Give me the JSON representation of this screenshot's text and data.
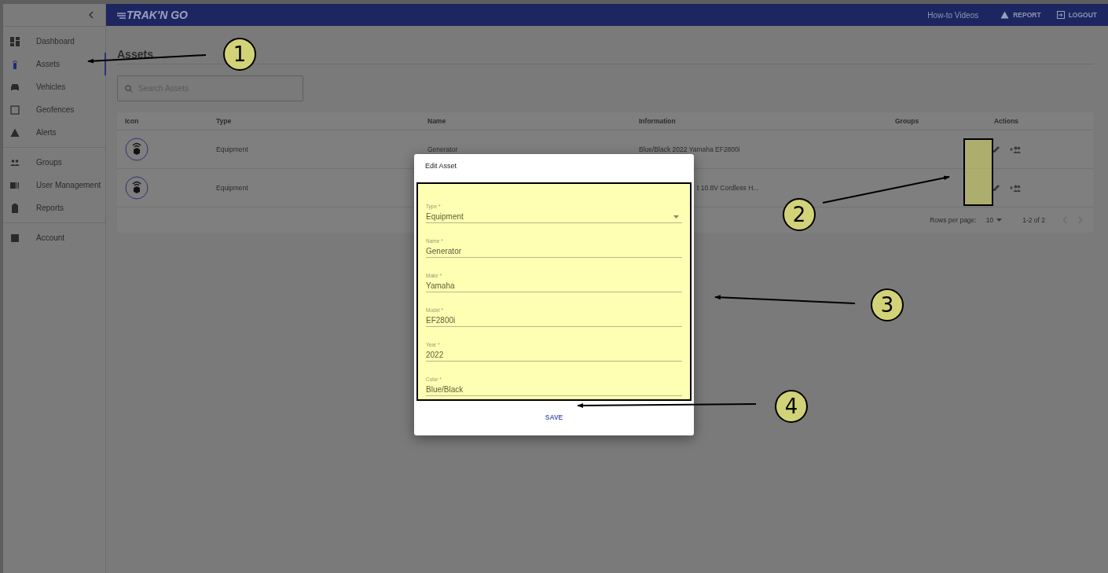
{
  "top_bar": {
    "logo": "TRAK'N GO",
    "links": [
      {
        "label": "How-to Videos",
        "kind": "text"
      },
      {
        "label": "REPORT",
        "kind": "report"
      },
      {
        "label": "LOGOUT",
        "kind": "logout"
      }
    ]
  },
  "sidebar": {
    "sections": [
      {
        "items": [
          {
            "label": "Dashboard",
            "selected": false
          },
          {
            "label": "Assets",
            "selected": true
          },
          {
            "label": "Vehicles",
            "selected": false
          },
          {
            "label": "Geofences",
            "selected": false
          },
          {
            "label": "Alerts",
            "selected": false
          }
        ]
      },
      {
        "items": [
          {
            "label": "Groups",
            "selected": false
          },
          {
            "label": "User Management",
            "selected": false
          },
          {
            "label": "Reports",
            "selected": false
          }
        ]
      },
      {
        "items": [
          {
            "label": "Account",
            "selected": false
          }
        ]
      }
    ]
  },
  "page": {
    "title": "Assets",
    "search": {
      "placeholder": "Search Assets"
    }
  },
  "table": {
    "columns": [
      "Icon",
      "Type",
      "Name",
      "Information",
      "Groups",
      "Actions"
    ],
    "rows": [
      {
        "type": "Equipment",
        "name": "Generator",
        "information": "Blue/Black 2022 Yamaha EF2800i",
        "behind_dialog": false
      },
      {
        "type": "Equipment",
        "information": "t 10.8V Cordless H...",
        "behind_dialog": true
      }
    ],
    "footer": {
      "rows_per_page_label": "Rows per page:",
      "rows_per_page": "10",
      "range": "1-2 of 2"
    }
  },
  "dialog": {
    "title": "Edit Asset",
    "fields": [
      {
        "label": "Type *",
        "value": "Equipment",
        "kind": "select"
      },
      {
        "label": "Name *",
        "value": "Generator",
        "kind": "text"
      },
      {
        "label": "Make *",
        "value": "Yamaha",
        "kind": "text"
      },
      {
        "label": "Model *",
        "value": "EF2800i",
        "kind": "text"
      },
      {
        "label": "Year *",
        "value": "2022",
        "kind": "text"
      },
      {
        "label": "Color *",
        "value": "Blue/Black",
        "kind": "text"
      }
    ],
    "save": "SAVE"
  },
  "callouts": [
    {
      "number": "1"
    },
    {
      "number": "2"
    },
    {
      "number": "3"
    },
    {
      "number": "4"
    }
  ]
}
